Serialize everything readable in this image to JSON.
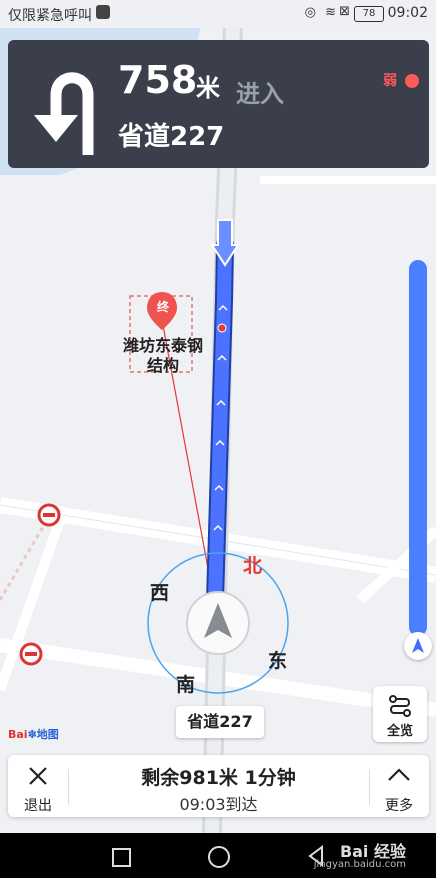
{
  "status_bar": {
    "carrier": "仅限紧急呼叫",
    "battery": "78",
    "time": "09:02"
  },
  "nav_card": {
    "distance_value": "758",
    "distance_unit": "米",
    "action": "进入",
    "road_name": "省道227",
    "signal": "弱"
  },
  "map": {
    "destination_marker": "终",
    "destination_name_line1": "潍坊东泰钢",
    "destination_name_line2": "结构",
    "compass": {
      "north": "北",
      "south": "南",
      "east": "东",
      "west": "西"
    },
    "current_road": "省道227",
    "logo_text": "Bai",
    "logo_text2": "地图"
  },
  "overview_button": {
    "label": "全览"
  },
  "bottom_bar": {
    "exit_label": "退出",
    "remaining": "剩余981米 1分钟",
    "arrival": "09:03到达",
    "more_label": "更多"
  },
  "system_nav": {
    "watermark": "Bai 经验",
    "watermark_url": "jingyan.baidu.com"
  },
  "colors": {
    "route": "#3d6bff",
    "nav_card_bg": "#3a3f4b",
    "accent_red": "#e53935",
    "slider": "#4a7fff"
  }
}
